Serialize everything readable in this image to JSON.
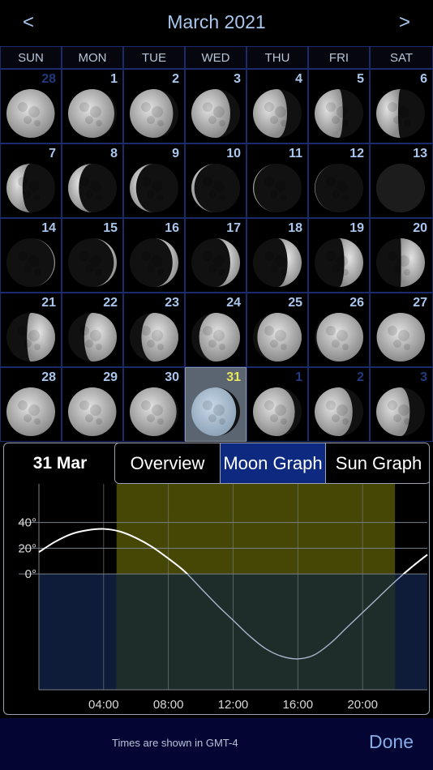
{
  "header": {
    "title": "March 2021",
    "prev": "<",
    "next": ">"
  },
  "weekdays": [
    "SUN",
    "MON",
    "TUE",
    "WED",
    "THU",
    "FRI",
    "SAT"
  ],
  "calendar": [
    {
      "day": "28",
      "illum": 0.99,
      "waxing": false,
      "other": true
    },
    {
      "day": "1",
      "illum": 0.95,
      "waxing": false
    },
    {
      "day": "2",
      "illum": 0.89,
      "waxing": false
    },
    {
      "day": "3",
      "illum": 0.8,
      "waxing": false
    },
    {
      "day": "4",
      "illum": 0.7,
      "waxing": false
    },
    {
      "day": "5",
      "illum": 0.58,
      "waxing": false
    },
    {
      "day": "6",
      "illum": 0.45,
      "waxing": false
    },
    {
      "day": "7",
      "illum": 0.33,
      "waxing": false
    },
    {
      "day": "8",
      "illum": 0.22,
      "waxing": false
    },
    {
      "day": "9",
      "illum": 0.13,
      "waxing": false
    },
    {
      "day": "10",
      "illum": 0.06,
      "waxing": false
    },
    {
      "day": "11",
      "illum": 0.02,
      "waxing": false
    },
    {
      "day": "12",
      "illum": 0.01,
      "waxing": false
    },
    {
      "day": "13",
      "illum": 0.0,
      "waxing": true
    },
    {
      "day": "14",
      "illum": 0.02,
      "waxing": true
    },
    {
      "day": "15",
      "illum": 0.06,
      "waxing": true
    },
    {
      "day": "16",
      "illum": 0.12,
      "waxing": true
    },
    {
      "day": "17",
      "illum": 0.2,
      "waxing": true
    },
    {
      "day": "18",
      "illum": 0.29,
      "waxing": true
    },
    {
      "day": "19",
      "illum": 0.39,
      "waxing": true
    },
    {
      "day": "20",
      "illum": 0.49,
      "waxing": true
    },
    {
      "day": "21",
      "illum": 0.58,
      "waxing": true
    },
    {
      "day": "22",
      "illum": 0.67,
      "waxing": true
    },
    {
      "day": "23",
      "illum": 0.76,
      "waxing": true
    },
    {
      "day": "24",
      "illum": 0.84,
      "waxing": true
    },
    {
      "day": "25",
      "illum": 0.91,
      "waxing": true
    },
    {
      "day": "26",
      "illum": 0.96,
      "waxing": true
    },
    {
      "day": "27",
      "illum": 0.99,
      "waxing": true
    },
    {
      "day": "28",
      "illum": 1.0,
      "waxing": true
    },
    {
      "day": "29",
      "illum": 0.99,
      "waxing": false
    },
    {
      "day": "30",
      "illum": 0.96,
      "waxing": false
    },
    {
      "day": "31",
      "illum": 0.92,
      "waxing": false,
      "today": true
    },
    {
      "day": "1",
      "illum": 0.86,
      "waxing": false,
      "other": true
    },
    {
      "day": "2",
      "illum": 0.78,
      "waxing": false,
      "other": true
    },
    {
      "day": "3",
      "illum": 0.69,
      "waxing": false,
      "other": true
    }
  ],
  "panel": {
    "date": "31 Mar",
    "tabs": [
      {
        "label": "Overview",
        "active": false
      },
      {
        "label": "Moon Graph",
        "active": true
      },
      {
        "label": "Sun Graph",
        "active": false
      }
    ]
  },
  "chart_data": {
    "type": "line",
    "xlabel": "",
    "ylabel": "",
    "xlim": [
      0,
      24
    ],
    "ylim": [
      -90,
      70
    ],
    "y_ticks": [
      {
        "v": 40,
        "label": "40°"
      },
      {
        "v": 20,
        "label": "20°"
      },
      {
        "v": 0,
        "label": "0°"
      }
    ],
    "x_ticks": [
      {
        "v": 4,
        "label": "04:00"
      },
      {
        "v": 8,
        "label": "08:00"
      },
      {
        "v": 12,
        "label": "12:00"
      },
      {
        "v": 16,
        "label": "16:00"
      },
      {
        "v": 20,
        "label": "20:00"
      }
    ],
    "daylight": [
      6.3,
      20.5
    ],
    "series": [
      {
        "x": [
          0,
          1,
          2,
          3,
          4,
          5,
          6,
          7,
          8,
          9,
          10,
          11,
          12,
          13,
          14,
          15,
          16,
          17,
          18,
          19,
          20,
          21,
          22,
          23,
          24
        ],
        "y": [
          17,
          25,
          31,
          34,
          35,
          33,
          28,
          21,
          12,
          2,
          -11,
          -24,
          -36,
          -48,
          -58,
          -64,
          -66,
          -63,
          -54,
          -42,
          -30,
          -18,
          -6,
          5,
          15
        ]
      }
    ]
  },
  "colors": {
    "daylight": "#4a4a05",
    "below": "#0e1c3a",
    "overlap": "#1c2c2c",
    "moon_line": "#ffffff"
  },
  "footer": {
    "tz": "Times are shown in GMT-4",
    "done": "Done"
  }
}
